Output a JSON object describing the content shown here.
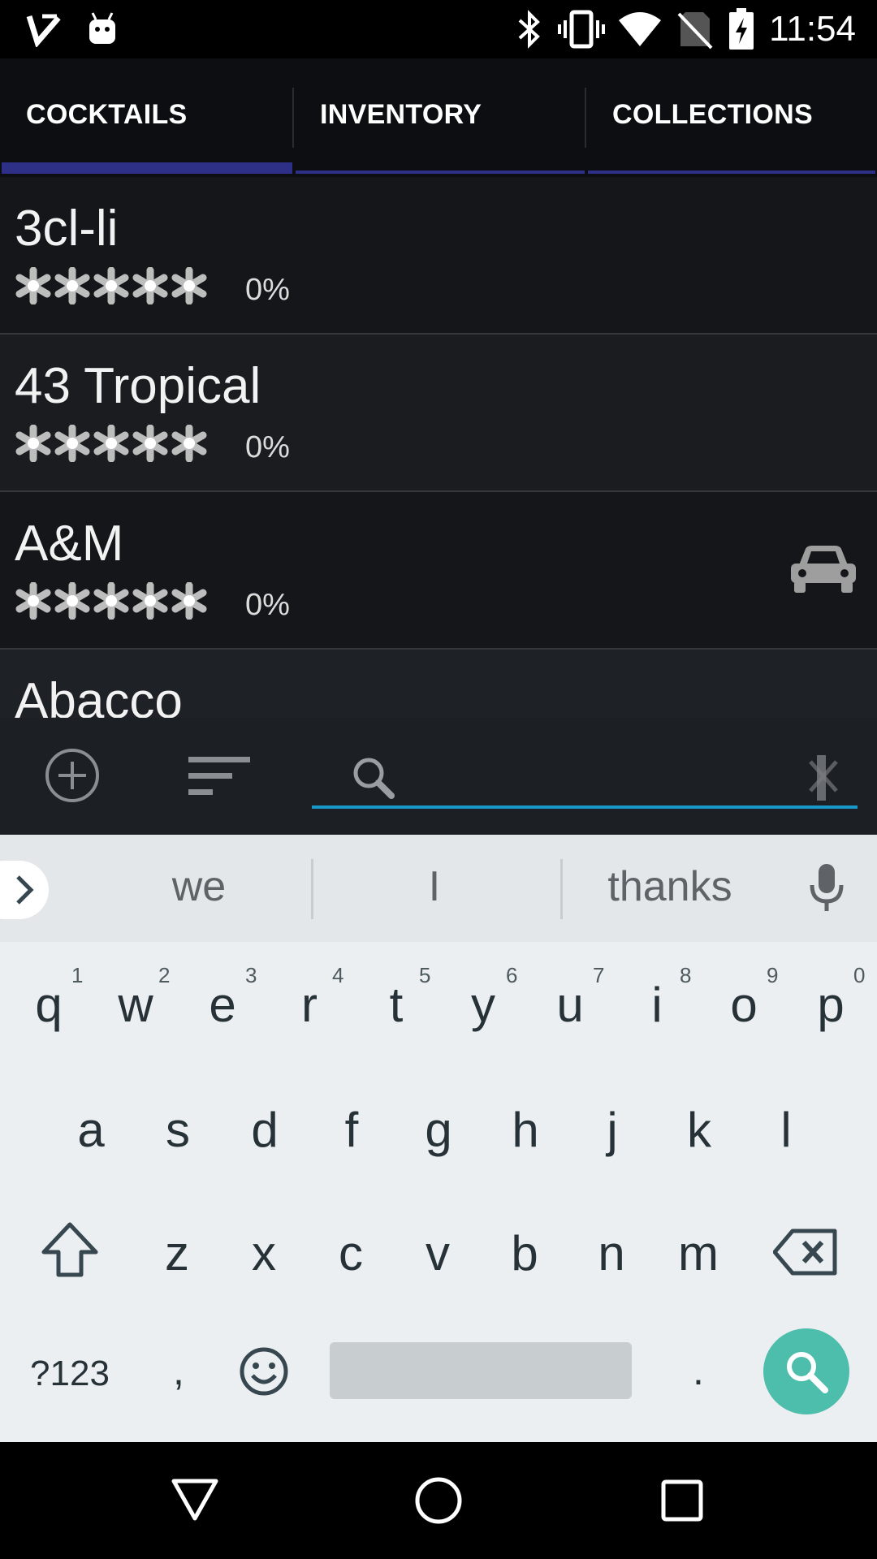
{
  "status_bar": {
    "time": "11:54",
    "left_icons": [
      "task-check-icon",
      "android-icon"
    ],
    "right_icons": [
      "bluetooth-icon",
      "vibrate-icon",
      "wifi-icon",
      "no-sim-icon",
      "battery-charging-icon"
    ]
  },
  "tabs": [
    {
      "label": "COCKTAILS",
      "active": true
    },
    {
      "label": "INVENTORY",
      "active": false
    },
    {
      "label": "COLLECTIONS",
      "active": false
    }
  ],
  "colors": {
    "accent": "#2e2f86",
    "search_underline": "#1a97c9",
    "search_key": "#4dbdac",
    "list_bg": "#141619"
  },
  "cocktails": [
    {
      "name": "3cl-li",
      "rating_stars": 0,
      "max_stars": 5,
      "percent": "0%",
      "icon": ""
    },
    {
      "name": "43 Tropical",
      "rating_stars": 0,
      "max_stars": 5,
      "percent": "0%",
      "icon": ""
    },
    {
      "name": "A&M",
      "rating_stars": 0,
      "max_stars": 5,
      "percent": "0%",
      "icon": "car-icon"
    },
    {
      "name": "Abacco",
      "rating_stars": 0,
      "max_stars": 5,
      "percent": "",
      "icon": ""
    }
  ],
  "toolbar": {
    "add_icon": "add-circle-icon",
    "sort_icon": "sort-icon",
    "search_icon": "search-icon",
    "search_value": "",
    "clear_icon": "close-icon"
  },
  "keyboard": {
    "suggestions": [
      "we",
      "I",
      "thanks"
    ],
    "row1": [
      "q",
      "w",
      "e",
      "r",
      "t",
      "y",
      "u",
      "i",
      "o",
      "p"
    ],
    "row1_hints": [
      "1",
      "2",
      "3",
      "4",
      "5",
      "6",
      "7",
      "8",
      "9",
      "0"
    ],
    "row2": [
      "a",
      "s",
      "d",
      "f",
      "g",
      "h",
      "j",
      "k",
      "l"
    ],
    "row3": [
      "z",
      "x",
      "c",
      "v",
      "b",
      "n",
      "m"
    ],
    "symbols_label": "?123",
    "comma": ",",
    "period": "."
  },
  "nav": [
    "back-icon",
    "home-icon",
    "recents-icon"
  ]
}
